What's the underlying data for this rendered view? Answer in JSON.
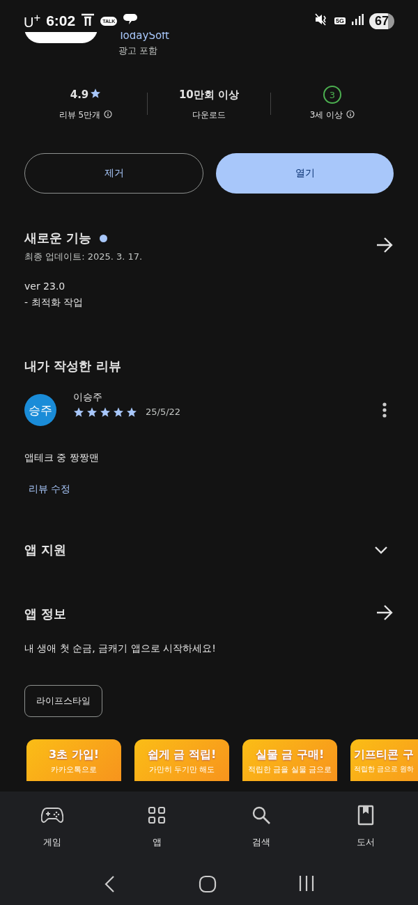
{
  "status_bar": {
    "carrier": "U$^{+}$",
    "time": "6:02",
    "talk_badge": "TALK",
    "network": "5G",
    "battery": "67"
  },
  "app": {
    "developer": "TodaySoft",
    "ads_note": "광고 포함"
  },
  "stats": [
    {
      "kind": "rating",
      "value": "4.9",
      "label": "리뷰 5만개",
      "info": true
    },
    {
      "kind": "plain",
      "value": "10만회 이상",
      "label": "다운로드",
      "info": false
    },
    {
      "kind": "age",
      "value": "3",
      "label": "3세 이상",
      "info": true
    }
  ],
  "buttons": [
    {
      "kind": "outline",
      "label": "제거"
    },
    {
      "kind": "filled",
      "label": "열기"
    }
  ],
  "whats_new": {
    "title": "새로운 기능",
    "new_dot": true,
    "date": "최종 업데이트: 2025. 3. 17.",
    "notes": [
      "ver 23.0",
      "- 최적화 작업"
    ]
  },
  "my_review": {
    "heading": "내가 작성한 리뷰",
    "author": "이승주",
    "avatar_text": "승주",
    "stars": 5,
    "date": "25/5/22",
    "text": "앱테크 중 짱짱맨",
    "edit_link": "리뷰 수정"
  },
  "app_support": {
    "title": "앱 지원",
    "expanded": false
  },
  "app_info": {
    "title": "앱 정보",
    "description": "내 생애 첫 순금, 금캐기 앱으로 시작하세요!",
    "tags": [
      "라이프스타일"
    ]
  },
  "screenshots": [
    {
      "title": "3초 가입!",
      "subtitle": "카카오톡으로"
    },
    {
      "title": "쉽게 금 적립!",
      "subtitle": "가만히 두기만 해도"
    },
    {
      "title": "실물 금 구매!",
      "subtitle": "적립한 금을 실물 금으로"
    },
    {
      "title": "기프티콘 구",
      "subtitle": "적립한 금으로 원하"
    }
  ],
  "bottom_nav": [
    {
      "label": "게임"
    },
    {
      "label": "앱"
    },
    {
      "label": "검색"
    },
    {
      "label": "도서"
    }
  ]
}
